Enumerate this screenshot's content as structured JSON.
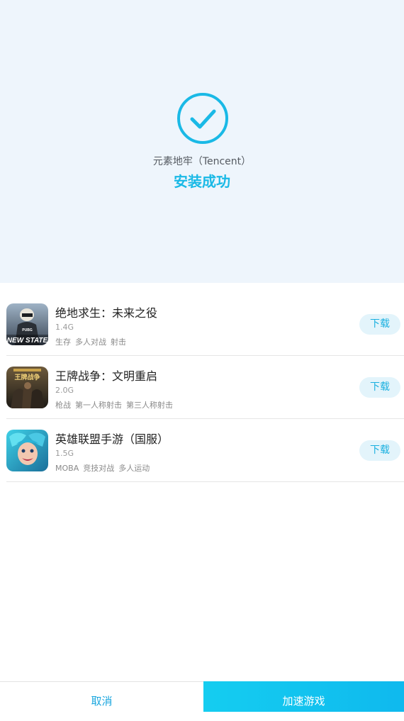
{
  "result": {
    "check_icon": "check-circle-icon",
    "app_name": "元素地牢（Tencent）",
    "status": "安装成功",
    "accent_color": "#1ab9e6"
  },
  "games": [
    {
      "title": "绝地求生：未来之役",
      "size": "1.4G",
      "tags": [
        "生存",
        "多人对战",
        "射击"
      ],
      "download_label": "下载",
      "icon_text": "NEW STATE",
      "icon_badge": "PUBG"
    },
    {
      "title": "王牌战争：文明重启",
      "size": "2.0G",
      "tags": [
        "枪战",
        "第一人称射击",
        "第三人称射击"
      ],
      "download_label": "下载",
      "icon_text": "王牌战争"
    },
    {
      "title": "英雄联盟手游（国服）",
      "size": "1.5G",
      "tags": [
        "MOBA",
        "竞技对战",
        "多人运动"
      ],
      "download_label": "下载"
    }
  ],
  "footer": {
    "cancel_label": "取消",
    "accelerate_label": "加速游戏"
  }
}
